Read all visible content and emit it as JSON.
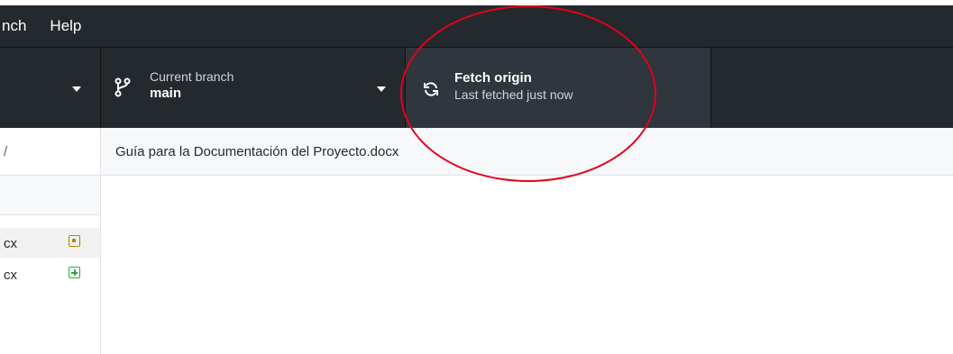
{
  "menubar": {
    "items": [
      "nch",
      "Help"
    ]
  },
  "toolbar": {
    "branch": {
      "label": "Current branch",
      "value": "main",
      "icon": "git-branch-icon"
    },
    "fetch": {
      "title": "Fetch origin",
      "subtitle": "Last fetched just now",
      "icon": "sync-icon"
    }
  },
  "sidebar": {
    "header_text": "/",
    "files": [
      {
        "name": "cx",
        "status": "modified",
        "selected": true
      },
      {
        "name": "cx",
        "status": "added",
        "selected": false
      }
    ]
  },
  "main": {
    "file_path": "Guía para la Documentación del Proyecto.docx"
  },
  "colors": {
    "toolbar_bg": "#24292e",
    "fetch_bg": "#2f363d",
    "annotation": "#e3001b",
    "modified": "#b08800",
    "added": "#28a745"
  }
}
